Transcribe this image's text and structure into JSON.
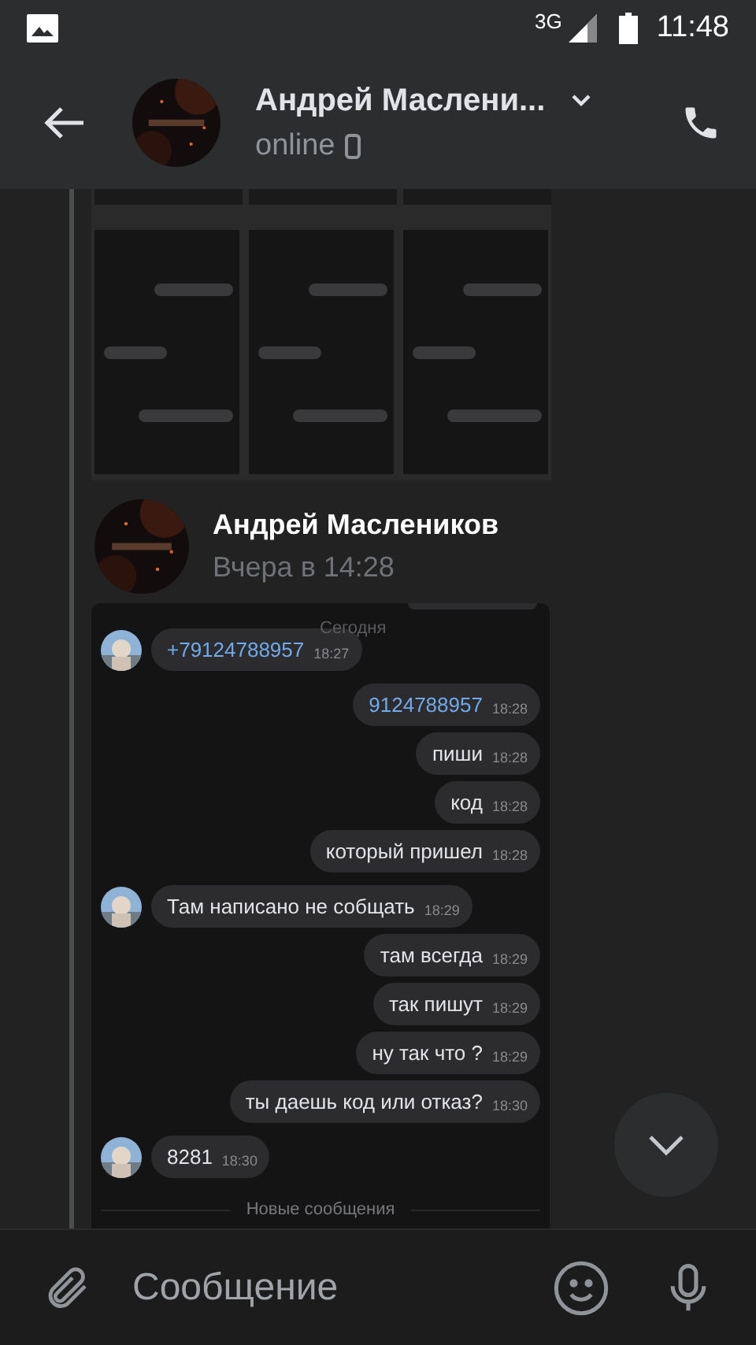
{
  "status_bar": {
    "network": "3G",
    "time": "11:48"
  },
  "header": {
    "title": "Андрей Маслени...",
    "status": "online"
  },
  "forwarded": {
    "author": "Андрей Маслеников",
    "time": "Вчера в 14:28",
    "screenshot": {
      "date_badge": "Сегодня",
      "divider": "Новые сообщения",
      "messages": [
        {
          "outgoing": false,
          "kind": "link",
          "text": "+79124788957",
          "time": "18:27"
        },
        {
          "outgoing": true,
          "kind": "link",
          "text": "9124788957",
          "time": "18:28"
        },
        {
          "outgoing": true,
          "kind": "text",
          "text": "пиши",
          "time": "18:28"
        },
        {
          "outgoing": true,
          "kind": "text",
          "text": "код",
          "time": "18:28"
        },
        {
          "outgoing": true,
          "kind": "text",
          "text": "который пришел",
          "time": "18:28"
        },
        {
          "outgoing": false,
          "kind": "text",
          "text": "Там написано не собщать",
          "time": "18:29"
        },
        {
          "outgoing": true,
          "kind": "text",
          "text": "там всегда",
          "time": "18:29"
        },
        {
          "outgoing": true,
          "kind": "text",
          "text": "так пишут",
          "time": "18:29"
        },
        {
          "outgoing": true,
          "kind": "text",
          "text": "ну так что ?",
          "time": "18:29"
        },
        {
          "outgoing": true,
          "kind": "text",
          "text": "ты даешь код или отказ?",
          "time": "18:30"
        },
        {
          "outgoing": false,
          "kind": "text",
          "text": "8281",
          "time": "18:30"
        }
      ]
    }
  },
  "composer": {
    "placeholder": "Сообщение"
  }
}
